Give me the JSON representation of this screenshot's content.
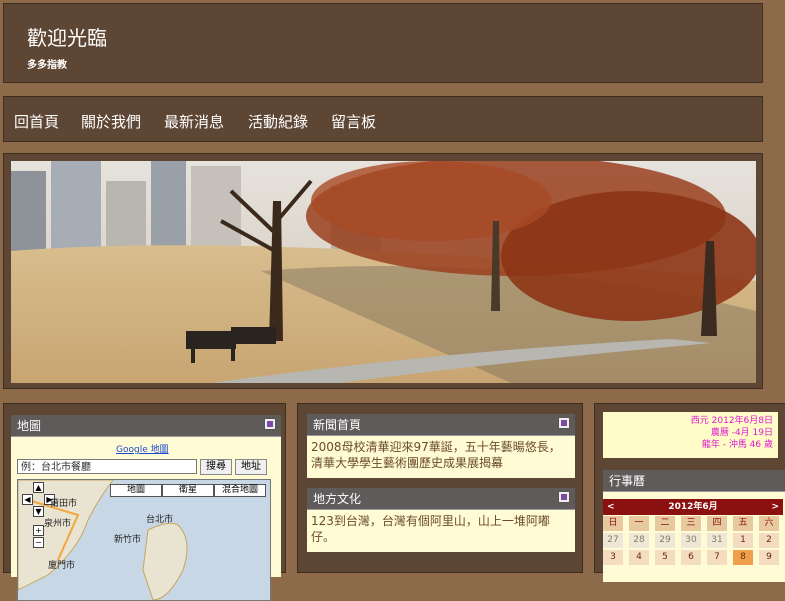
{
  "header": {
    "title": "歡迎光臨",
    "subtitle": "多多指教"
  },
  "nav": {
    "items": [
      {
        "label": "回首頁"
      },
      {
        "label": "關於我們"
      },
      {
        "label": "最新消息"
      },
      {
        "label": "活動紀錄"
      },
      {
        "label": "留言板"
      }
    ]
  },
  "map_widget": {
    "title": "地圖",
    "google_link": "Google 地圖",
    "search_placeholder": "例：台北市餐廳",
    "search_button": "搜尋",
    "address_button": "地址",
    "map_types": [
      "地圖",
      "衛星",
      "混合地圖"
    ],
    "labels": [
      "莆田市",
      "泉州市",
      "台北市",
      "新竹市",
      "廈門市"
    ]
  },
  "news_widget": {
    "title": "新聞首頁",
    "text": "2008母校清華迎來97華誕，五十年藝暘悠長，清華大學學生藝術團歷史成果展揭幕"
  },
  "local_widget": {
    "title": "地方文化",
    "text": "123到台灣，台灣有個阿里山，山上一堆阿嘟仔。"
  },
  "date_widget": {
    "gregorian": "西元 2012年6月8日",
    "lunar": "農曆 -4月 19日",
    "zodiac": "龍年 - 沖馬 46 歲"
  },
  "calendar_widget": {
    "title": "行事曆",
    "prev": "<",
    "next": ">",
    "month": "2012年6月",
    "weekdays": [
      "日",
      "一",
      "二",
      "三",
      "四",
      "五",
      "六"
    ],
    "days": [
      "27",
      "28",
      "29",
      "30",
      "31",
      "1",
      "2",
      "3",
      "4",
      "5",
      "6",
      "7",
      "8",
      "9"
    ]
  },
  "colors": {
    "accent": "#8b1010",
    "panel": "#5e4634",
    "page": "#8d6b4a"
  }
}
